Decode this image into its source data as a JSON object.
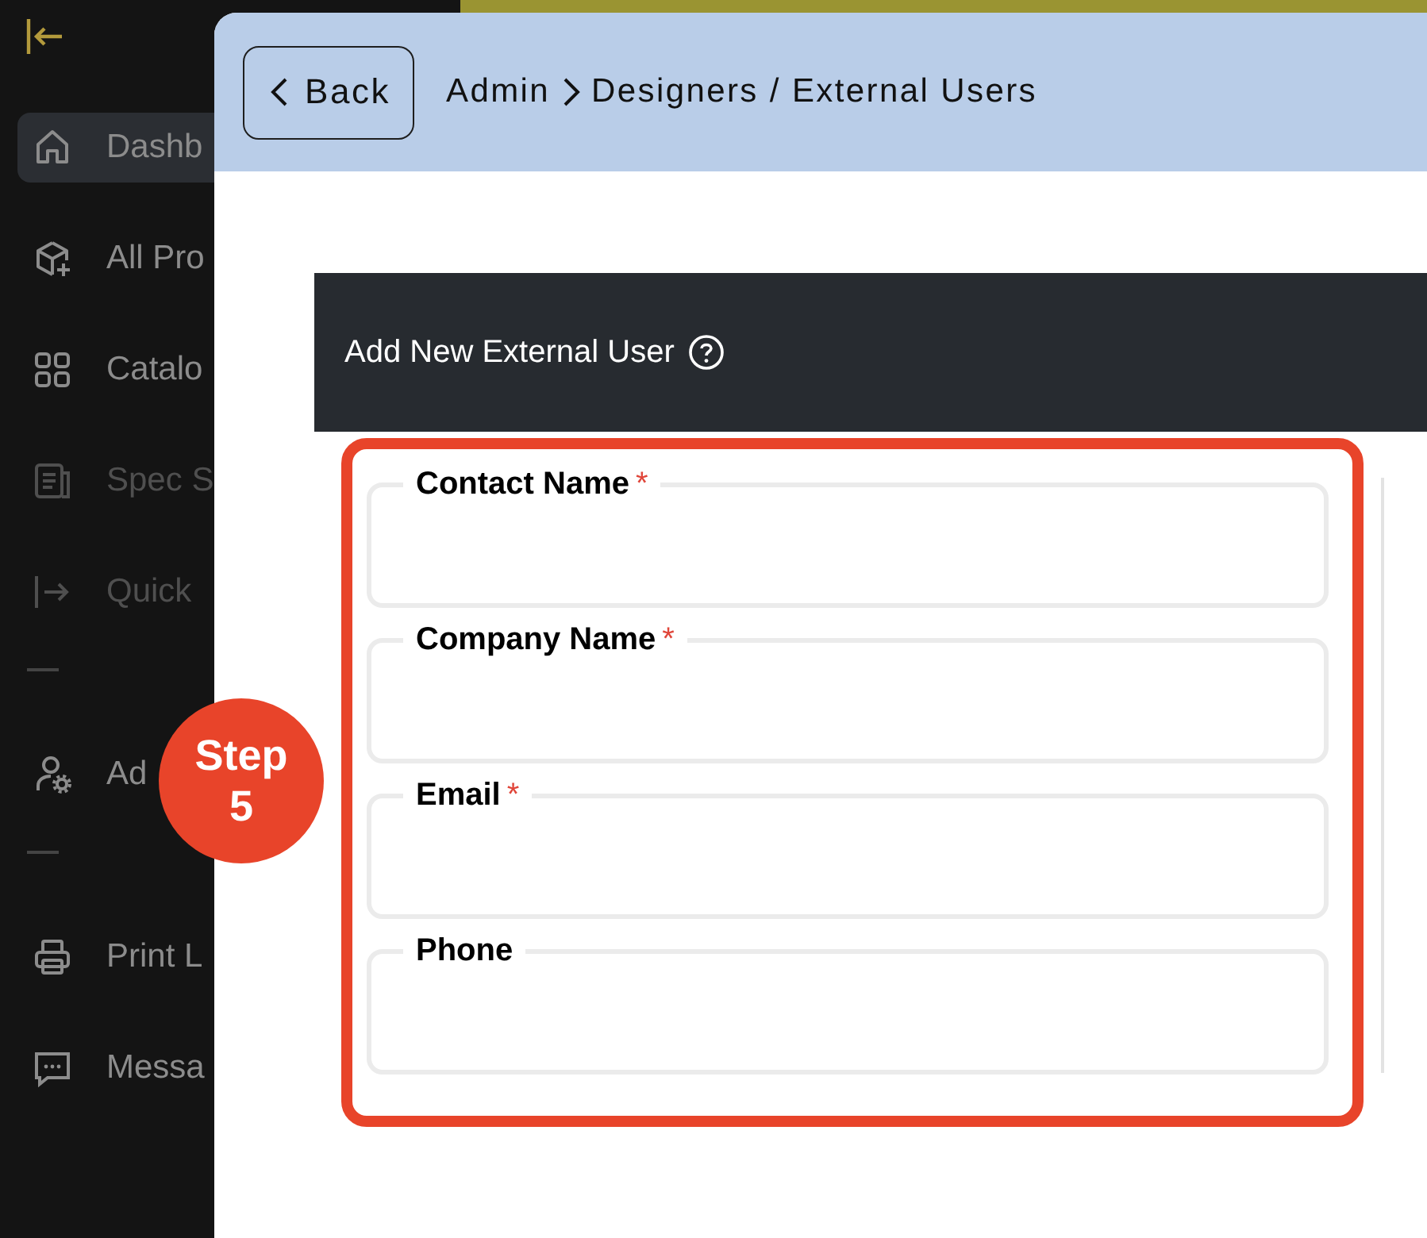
{
  "sidebar": {
    "sections": [
      {
        "items": [
          {
            "label": "Dashb",
            "selected": true,
            "disabled": false
          },
          {
            "label": "All Pro",
            "selected": false,
            "disabled": false
          },
          {
            "label": "Catalo",
            "selected": false,
            "disabled": false
          },
          {
            "label": "Spec S",
            "selected": false,
            "disabled": true
          },
          {
            "label": "Quick",
            "selected": false,
            "disabled": true
          }
        ]
      },
      {
        "items": [
          {
            "label": "Ad",
            "selected": false,
            "disabled": false
          }
        ]
      },
      {
        "items": [
          {
            "label": "Print L",
            "selected": false,
            "disabled": false
          },
          {
            "label": "Messa",
            "selected": false,
            "disabled": false
          }
        ]
      }
    ]
  },
  "header": {
    "back_button": "Back",
    "breadcrumb": [
      "Admin",
      "Designers / External Users"
    ]
  },
  "card": {
    "title": "Add New External User"
  },
  "form": {
    "fields": [
      {
        "label": "Contact Name",
        "required_mark": "*"
      },
      {
        "label": "Company Name",
        "required_mark": "*"
      },
      {
        "label": "Email",
        "required_mark": "*"
      },
      {
        "label": "Phone"
      }
    ]
  },
  "annotation": {
    "label": "Step",
    "number": "5"
  }
}
